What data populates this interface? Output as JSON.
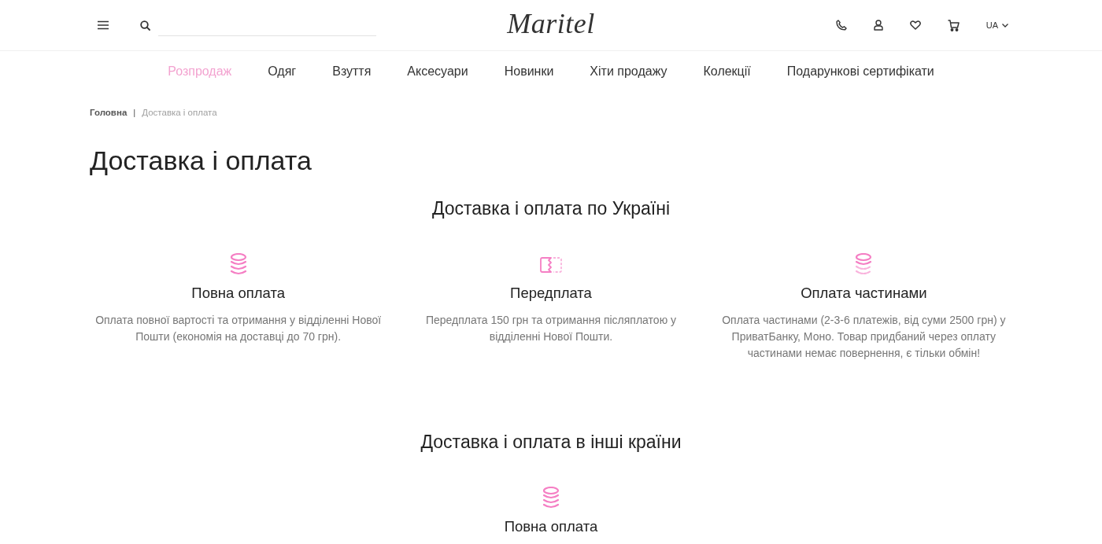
{
  "header": {
    "logo": "Maritel",
    "language": "UA"
  },
  "nav": [
    {
      "label": "Розпродаж",
      "selected": true
    },
    {
      "label": "Одяг",
      "selected": false
    },
    {
      "label": "Взуття",
      "selected": false
    },
    {
      "label": "Аксесуари",
      "selected": false
    },
    {
      "label": "Новинки",
      "selected": false
    },
    {
      "label": "Хіти продажу",
      "selected": false
    },
    {
      "label": "Колекції",
      "selected": false
    },
    {
      "label": "Подарункові сертифікати",
      "selected": false
    }
  ],
  "breadcrumbs": [
    {
      "label": "Головна",
      "current": false
    },
    {
      "label": "Доставка і оплата",
      "current": true
    }
  ],
  "breadcrumb_separator": "|",
  "title": "Доставка і оплата",
  "sections": [
    {
      "heading": "Доставка і оплата по Україні",
      "options": [
        {
          "kind": "coins",
          "title": "Повна оплата",
          "description": "Оплата повної вартості та отримання у відділенні Нової Пошти (економія на доставці до 70 грн)."
        },
        {
          "kind": "card-split",
          "title": "Передплата",
          "description": "Передплата 150 грн та отримання післяплатою у відділенні Нової Пошти."
        },
        {
          "kind": "coins-partial",
          "title": "Оплата частинами",
          "description": "Оплата частинами (2-3-6 платежів, від суми 2500 грн) у ПриватБанку, Моно. Товар придбаний через оплату частинами немає повернення, є тільки обмін!"
        }
      ]
    },
    {
      "heading": "Доставка і оплата в інші країни",
      "options": [
        {
          "kind": "coins",
          "title": "Повна оплата"
        }
      ]
    }
  ]
}
